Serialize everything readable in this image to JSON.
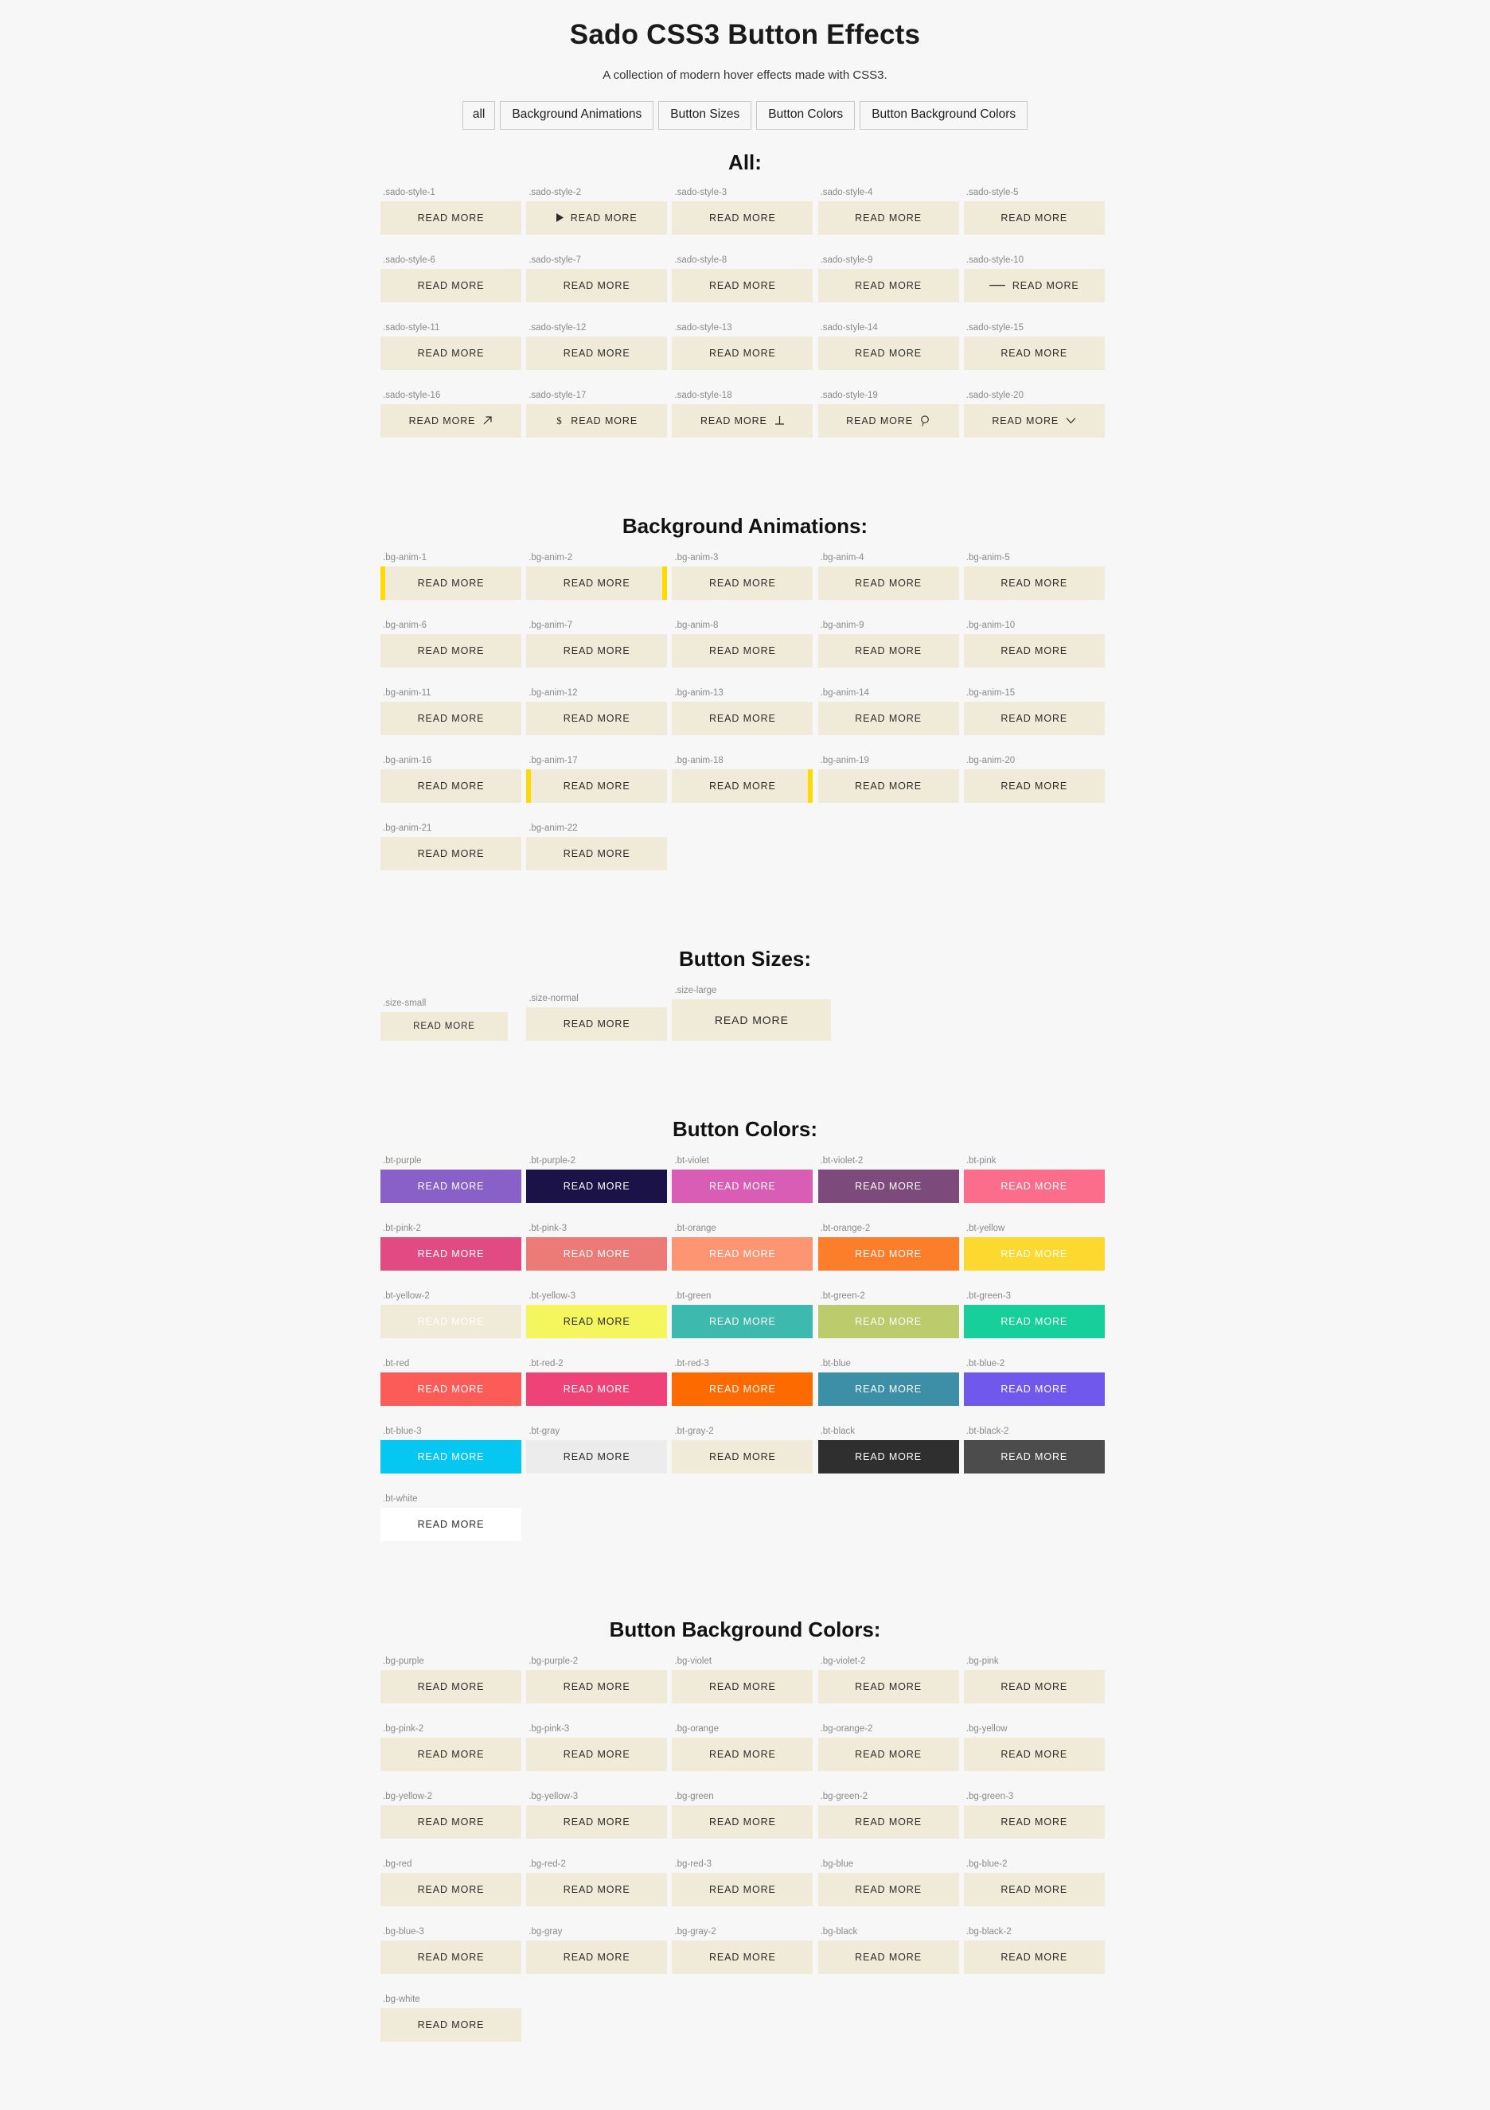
{
  "header": {
    "title": "Sado CSS3 Button Effects",
    "subtitle": "A collection of modern hover effects made with CSS3."
  },
  "filters": [
    {
      "label": "all",
      "active": true
    },
    {
      "label": "Background Animations",
      "active": false
    },
    {
      "label": "Button Sizes",
      "active": false
    },
    {
      "label": "Button Colors",
      "active": false
    },
    {
      "label": "Button Background Colors",
      "active": false
    }
  ],
  "button_label": "READ MORE",
  "colors": {
    "page_bg": "#f7f7f7",
    "button_default_bg": "#f0ead8",
    "button_default_text": "#2b2b2b",
    "label_text": "#8a8a8a",
    "anim_sliver": "#ffd900"
  },
  "sections": [
    {
      "title": "All:",
      "name": "all",
      "items": [
        {
          "label": ".sado-style-1",
          "icon": null
        },
        {
          "label": ".sado-style-2",
          "icon": "play-triangle-icon",
          "icon_side": "left"
        },
        {
          "label": ".sado-style-3",
          "icon": null
        },
        {
          "label": ".sado-style-4",
          "icon": null
        },
        {
          "label": ".sado-style-5",
          "icon": null
        },
        {
          "label": ".sado-style-6",
          "icon": null
        },
        {
          "label": ".sado-style-7",
          "icon": null
        },
        {
          "label": ".sado-style-8",
          "icon": null
        },
        {
          "label": ".sado-style-9",
          "icon": null
        },
        {
          "label": ".sado-style-10",
          "icon": "dash-line-icon",
          "icon_side": "left"
        },
        {
          "label": ".sado-style-11",
          "icon": null
        },
        {
          "label": ".sado-style-12",
          "icon": null
        },
        {
          "label": ".sado-style-13",
          "icon": null
        },
        {
          "label": ".sado-style-14",
          "icon": null
        },
        {
          "label": ".sado-style-15",
          "icon": null
        },
        {
          "label": ".sado-style-16",
          "icon": "arrow-up-right-icon",
          "icon_side": "right"
        },
        {
          "label": ".sado-style-17",
          "icon": "dollar-icon",
          "icon_side": "left"
        },
        {
          "label": ".sado-style-18",
          "icon": "perpendicular-icon",
          "icon_side": "right"
        },
        {
          "label": ".sado-style-19",
          "icon": "search-icon",
          "icon_side": "right"
        },
        {
          "label": ".sado-style-20",
          "icon": "chevron-down-icon",
          "icon_side": "right"
        }
      ]
    },
    {
      "title": "Background Animations:",
      "name": "background-animations",
      "items": [
        {
          "label": ".bg-anim-1",
          "sliver": "left"
        },
        {
          "label": ".bg-anim-2",
          "sliver": "right"
        },
        {
          "label": ".bg-anim-3",
          "sliver": null
        },
        {
          "label": ".bg-anim-4",
          "sliver": null
        },
        {
          "label": ".bg-anim-5",
          "sliver": null
        },
        {
          "label": ".bg-anim-6",
          "sliver": null
        },
        {
          "label": ".bg-anim-7",
          "sliver": null
        },
        {
          "label": ".bg-anim-8",
          "sliver": null
        },
        {
          "label": ".bg-anim-9",
          "sliver": null
        },
        {
          "label": ".bg-anim-10",
          "sliver": null
        },
        {
          "label": ".bg-anim-11",
          "sliver": null
        },
        {
          "label": ".bg-anim-12",
          "sliver": null
        },
        {
          "label": ".bg-anim-13",
          "sliver": null
        },
        {
          "label": ".bg-anim-14",
          "sliver": null
        },
        {
          "label": ".bg-anim-15",
          "sliver": null
        },
        {
          "label": ".bg-anim-16",
          "sliver": null
        },
        {
          "label": ".bg-anim-17",
          "sliver": "left"
        },
        {
          "label": ".bg-anim-18",
          "sliver": "right"
        },
        {
          "label": ".bg-anim-19",
          "sliver": null
        },
        {
          "label": ".bg-anim-20",
          "sliver": null
        },
        {
          "label": ".bg-anim-21",
          "sliver": null
        },
        {
          "label": ".bg-anim-22",
          "sliver": null
        }
      ]
    },
    {
      "title": "Button Sizes:",
      "name": "button-sizes",
      "items": [
        {
          "label": ".size-small",
          "size": "sz-small"
        },
        {
          "label": ".size-normal",
          "size": "sz-normal"
        },
        {
          "label": ".size-large",
          "size": "sz-large"
        }
      ]
    },
    {
      "title": "Button Colors:",
      "name": "button-colors",
      "items": [
        {
          "label": ".bt-purple",
          "bg": "#8860c8",
          "fg": "#ffffff"
        },
        {
          "label": ".bt-purple-2",
          "bg": "#1b1247",
          "fg": "#ffffff"
        },
        {
          "label": ".bt-violet",
          "bg": "#d95db4",
          "fg": "#ffffff"
        },
        {
          "label": ".bt-violet-2",
          "bg": "#7c4b7c",
          "fg": "#ffffff"
        },
        {
          "label": ".bt-pink",
          "bg": "#fc6d8c",
          "fg": "#ffffff"
        },
        {
          "label": ".bt-pink-2",
          "bg": "#e14b82",
          "fg": "#ffffff"
        },
        {
          "label": ".bt-pink-3",
          "bg": "#ec7a77",
          "fg": "#ffffff"
        },
        {
          "label": ".bt-orange",
          "bg": "#fd9573",
          "fg": "#ffffff"
        },
        {
          "label": ".bt-orange-2",
          "bg": "#fd7e2a",
          "fg": "#ffffff"
        },
        {
          "label": ".bt-yellow",
          "bg": "#fcd92e",
          "fg": "#ffffff"
        },
        {
          "label": ".bt-yellow-2",
          "bg": "#fbb košetc",
          "fg": "#ffffff"
        },
        {
          "label": ".bt-yellow-3",
          "bg": "#f5f55e",
          "fg": "#2b2b2b"
        },
        {
          "label": ".bt-green",
          "bg": "#3eb9ae",
          "fg": "#ffffff"
        },
        {
          "label": ".bt-green-2",
          "bg": "#bccb6c",
          "fg": "#ffffff"
        },
        {
          "label": ".bt-green-3",
          "bg": "#17cf9b",
          "fg": "#ffffff"
        },
        {
          "label": ".bt-red",
          "bg": "#fc5c57",
          "fg": "#ffffff"
        },
        {
          "label": ".bt-red-2",
          "bg": "#ef4279",
          "fg": "#ffffff"
        },
        {
          "label": ".bt-red-3",
          "bg": "#fd6a00",
          "fg": "#ffffff"
        },
        {
          "label": ".bt-blue",
          "bg": "#3d8fa8",
          "fg": "#ffffff"
        },
        {
          "label": ".bt-blue-2",
          "bg": "#7158ec",
          "fg": "#ffffff"
        },
        {
          "label": ".bt-blue-3",
          "bg": "#06c7f1",
          "fg": "#ffffff"
        },
        {
          "label": ".bt-gray",
          "bg": "#ececec",
          "fg": "#2b2b2b"
        },
        {
          "label": ".bt-gray-2",
          "bg": "#f0ead8",
          "fg": "#2b2b2b"
        },
        {
          "label": ".bt-black",
          "bg": "#2f2f2f",
          "fg": "#ffffff"
        },
        {
          "label": ".bt-black-2",
          "bg": "#4c4c4c",
          "fg": "#ffffff"
        },
        {
          "label": ".bt-white",
          "bg": "#ffffff",
          "fg": "#2b2b2b"
        }
      ]
    },
    {
      "title": "Button Background Colors:",
      "name": "button-background-colors",
      "items": [
        {
          "label": ".bg-purple"
        },
        {
          "label": ".bg-purple-2"
        },
        {
          "label": ".bg-violet"
        },
        {
          "label": ".bg-violet-2"
        },
        {
          "label": ".bg-pink"
        },
        {
          "label": ".bg-pink-2"
        },
        {
          "label": ".bg-pink-3"
        },
        {
          "label": ".bg-orange"
        },
        {
          "label": ".bg-orange-2"
        },
        {
          "label": ".bg-yellow"
        },
        {
          "label": ".bg-yellow-2"
        },
        {
          "label": ".bg-yellow-3"
        },
        {
          "label": ".bg-green"
        },
        {
          "label": ".bg-green-2"
        },
        {
          "label": ".bg-green-3"
        },
        {
          "label": ".bg-red"
        },
        {
          "label": ".bg-red-2"
        },
        {
          "label": ".bg-red-3"
        },
        {
          "label": ".bg-blue"
        },
        {
          "label": ".bg-blue-2"
        },
        {
          "label": ".bg-blue-3"
        },
        {
          "label": ".bg-gray"
        },
        {
          "label": ".bg-gray-2"
        },
        {
          "label": ".bg-black"
        },
        {
          "label": ".bg-black-2"
        },
        {
          "label": ".bg-white"
        }
      ]
    }
  ]
}
